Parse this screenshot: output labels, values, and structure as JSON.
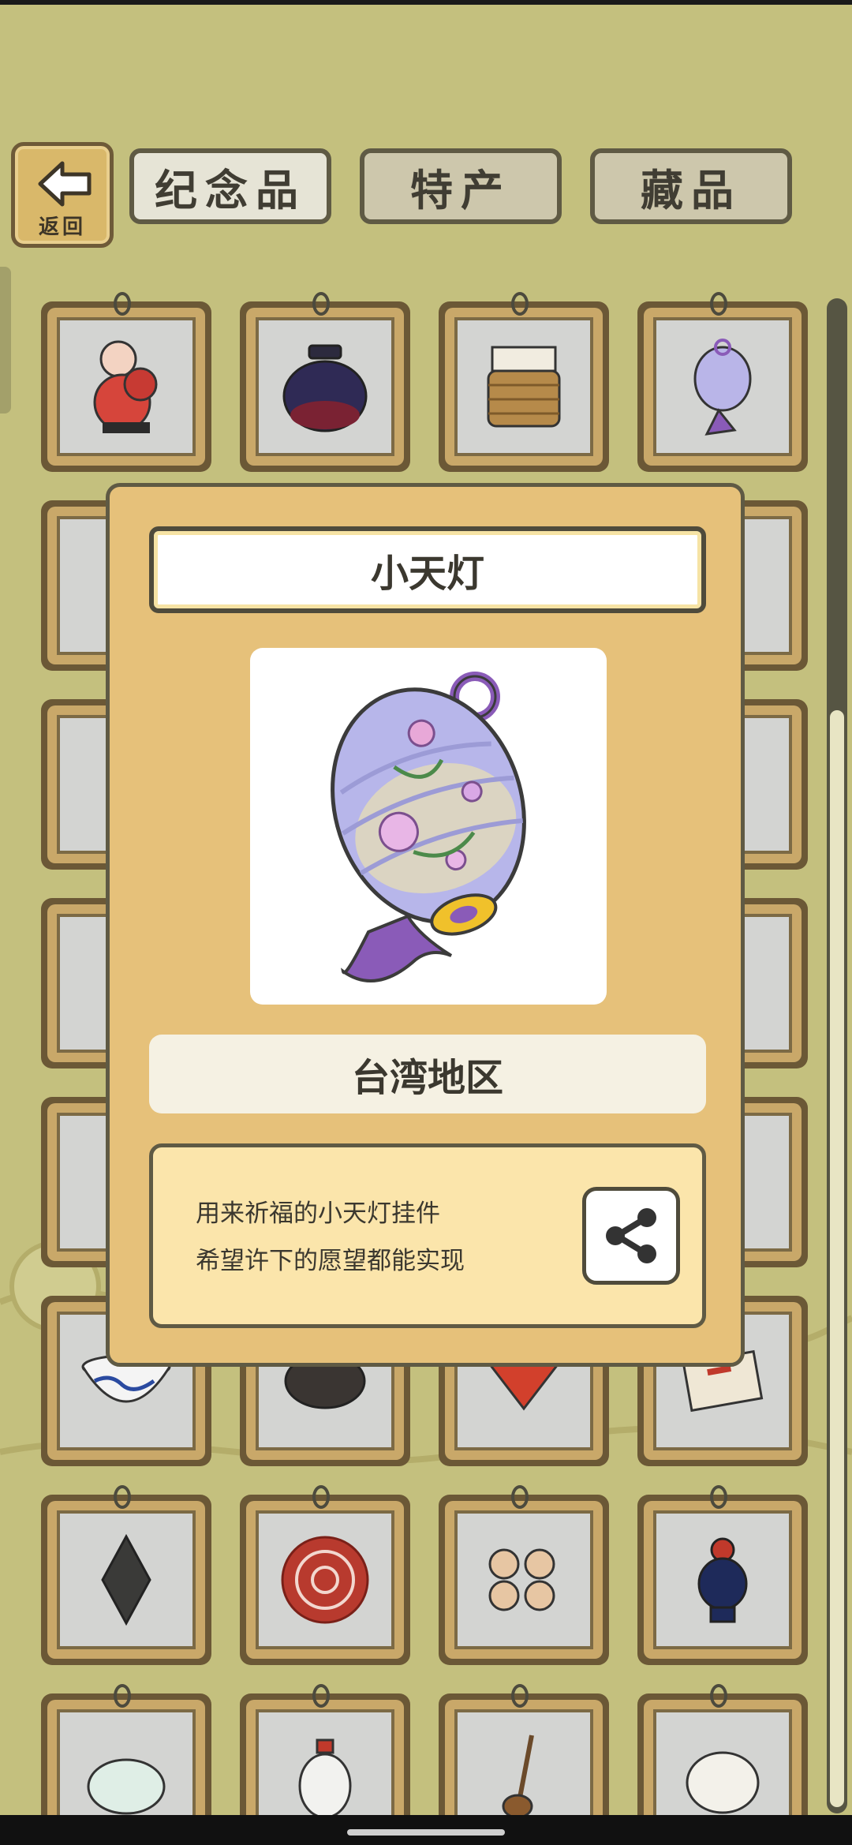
{
  "nav": {
    "back_label": "返回",
    "tabs": [
      "纪念品",
      "特产",
      "藏品"
    ]
  },
  "modal": {
    "title": "小天灯",
    "region": "台湾地区",
    "description": [
      "用来祈福的小天灯挂件",
      "希望许下的愿望都能实现"
    ],
    "share_icon": "share-icon"
  },
  "grid": {
    "visible_items": [
      "clay-figurine-icon",
      "dark-jar-icon",
      "wicker-cup-icon",
      "porcelain-lantern-icon",
      "blue-white-bowl-icon",
      "inkstone-icon",
      "red-fan-icon",
      "certificate-icon",
      "dark-stone-pendant-icon",
      "paper-cut-icon",
      "rabbit-figures-icon",
      "rooster-figurine-icon",
      "jade-carving-icon",
      "snuff-bottle-icon",
      "string-instrument-icon",
      "white-stone-icon"
    ]
  }
}
